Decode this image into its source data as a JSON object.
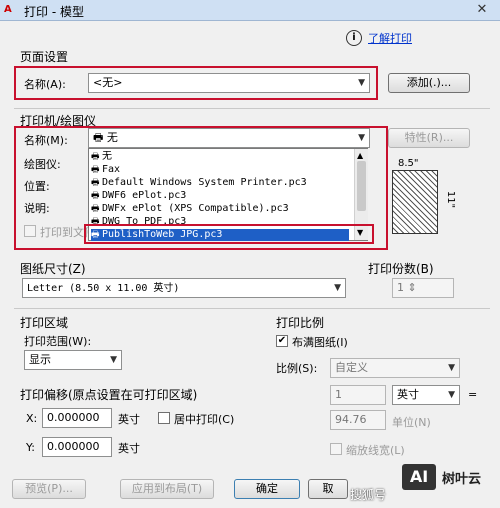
{
  "window": {
    "title": "打印 - 模型",
    "app_icon": "A",
    "close": "✕"
  },
  "help": {
    "link": "了解打印",
    "icon": "i"
  },
  "page_setup": {
    "group": "页面设置",
    "name_label": "名称(A):",
    "name_value": "<无>",
    "add_button": "添加(.)..."
  },
  "printer": {
    "group": "打印机/绘图仪",
    "name_label": "名称(M):",
    "name_value": "无",
    "properties_button": "特性(R)...",
    "plotter_label": "绘图仪:",
    "location_label": "位置:",
    "description_label": "说明:",
    "print_to_file_label": "打印到文件",
    "dim_width": "8.5\"",
    "dim_height": "11\"",
    "dropdown_items": [
      "无",
      "Fax",
      "Default Windows System Printer.pc3",
      "DWF6 ePlot.pc3",
      "DWFx ePlot (XPS Compatible).pc3",
      "DWG To PDF.pc3",
      "PublishToWeb JPG.pc3"
    ]
  },
  "paper_size": {
    "group": "图纸尺寸(Z)",
    "value": "Letter (8.50 x 11.00 英寸)"
  },
  "copies": {
    "group": "打印份数(B)",
    "value": "1"
  },
  "plot_area": {
    "group": "打印区域",
    "range_label": "打印范围(W):",
    "range_value": "显示"
  },
  "plot_offset": {
    "group": "打印偏移(原点设置在可打印区域)",
    "x_label": "X:",
    "x_value": "0.000000",
    "x_unit": "英寸",
    "y_label": "Y:",
    "y_value": "0.000000",
    "y_unit": "英寸",
    "center_label": "居中打印(C)"
  },
  "plot_scale": {
    "group": "打印比例",
    "fit_label": "布满图纸(I)",
    "fit_checked": "✔",
    "scale_label": "比例(S):",
    "scale_value": "自定义",
    "num_value": "1",
    "unit_value": "英寸",
    "equals": "=",
    "units_value": "94.76",
    "units_label": "单位(N)",
    "lineweight_label": "缩放线宽(L)"
  },
  "buttons": {
    "preview": "预览(P)...",
    "apply": "应用到布局(T)",
    "ok": "确定",
    "cancel": "取"
  },
  "watermark": {
    "logo": "AI",
    "text": "搜狐号",
    "brand": "树叶云"
  }
}
